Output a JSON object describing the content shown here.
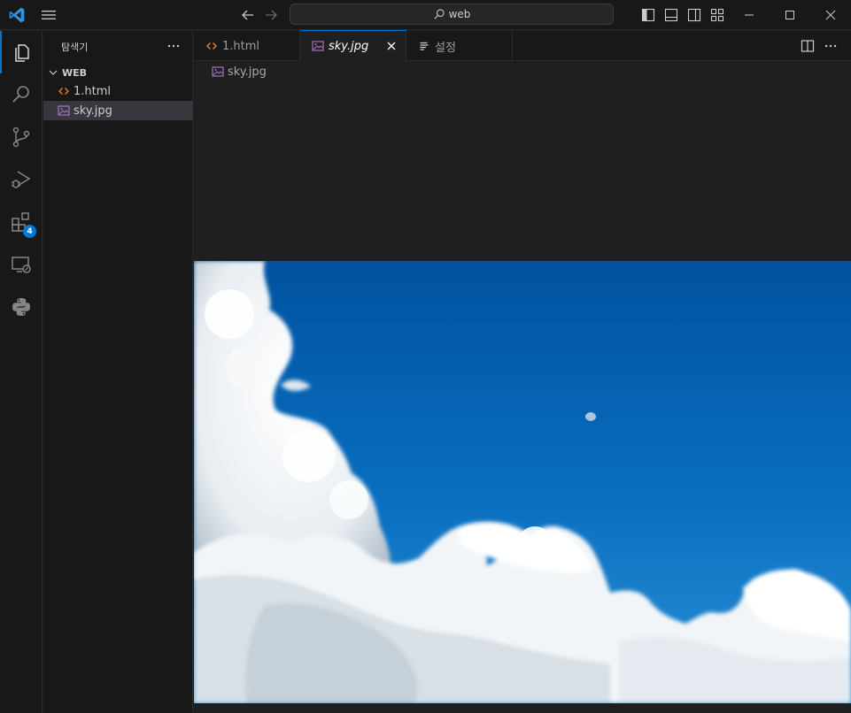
{
  "titlebar": {
    "search_label": "web",
    "window_buttons": [
      "minimize",
      "maximize",
      "close"
    ]
  },
  "activity_bar": {
    "items": [
      {
        "name": "explorer-icon",
        "active": true
      },
      {
        "name": "search-icon"
      },
      {
        "name": "source-control-icon"
      },
      {
        "name": "run-debug-icon"
      },
      {
        "name": "extensions-icon",
        "badge": "4"
      },
      {
        "name": "remote-explorer-icon"
      },
      {
        "name": "python-icon"
      }
    ]
  },
  "sidebar": {
    "title": "탐색기",
    "section": "WEB",
    "files": [
      {
        "label": "1.html",
        "icon": "html-file-icon"
      },
      {
        "label": "sky.jpg",
        "icon": "image-file-icon",
        "selected": true
      }
    ]
  },
  "tabs": [
    {
      "label": "1.html",
      "icon": "html-file-icon"
    },
    {
      "label": "sky.jpg",
      "icon": "image-file-icon",
      "active": true
    },
    {
      "label": "설정",
      "icon": "settings-file-icon"
    }
  ],
  "breadcrumb": {
    "file": "sky.jpg"
  },
  "colors": {
    "accent": "#0078d4",
    "html_icon": "#e37933",
    "image_icon": "#a074c4",
    "sky_top": "#0053a0",
    "sky_bottom": "#1c86cf"
  }
}
